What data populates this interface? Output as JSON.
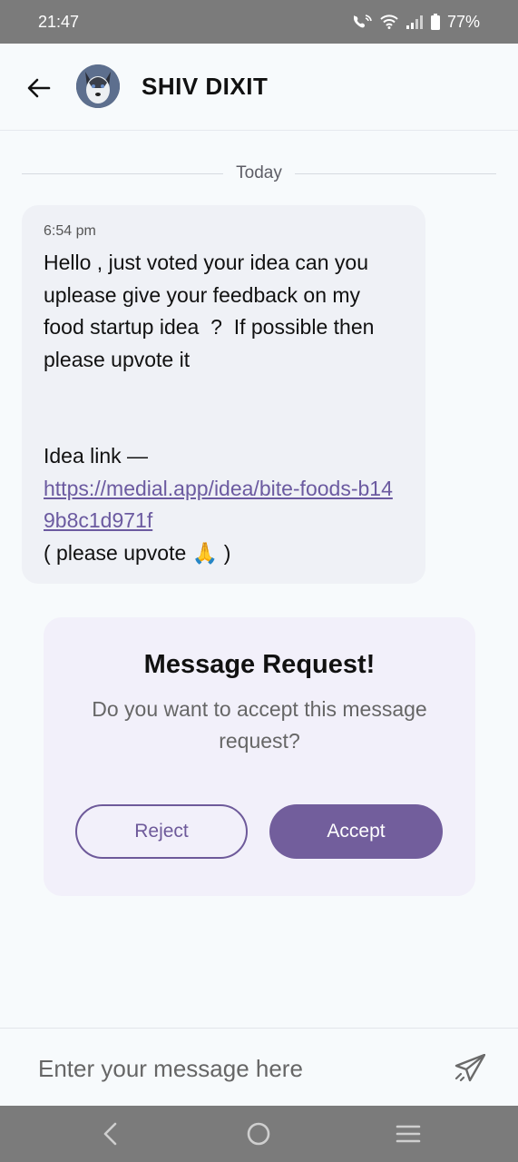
{
  "status_bar": {
    "time": "21:47",
    "battery": "77%"
  },
  "header": {
    "contact_name": "SHIV DIXIT"
  },
  "conversation": {
    "date_label": "Today",
    "message": {
      "time": "6:54 pm",
      "text": "Hello , just voted your idea can you uplease give your feedback on my food startup idea  ?  If possible then please upvote it\n\n\nIdea link —",
      "link": "https://medial.app/idea/bite-foods-b149b8c1d971f",
      "after_link": "( please upvote 🙏 )"
    }
  },
  "request": {
    "title": "Message Request!",
    "subtitle": "Do you want to accept this message request?",
    "reject_label": "Reject",
    "accept_label": "Accept"
  },
  "composer": {
    "placeholder": "Enter your message here"
  },
  "colors": {
    "accent": "#725e9c",
    "status_bar": "#7b7b7b",
    "bubble": "#eff1f6",
    "card": "#f2f0fa"
  }
}
